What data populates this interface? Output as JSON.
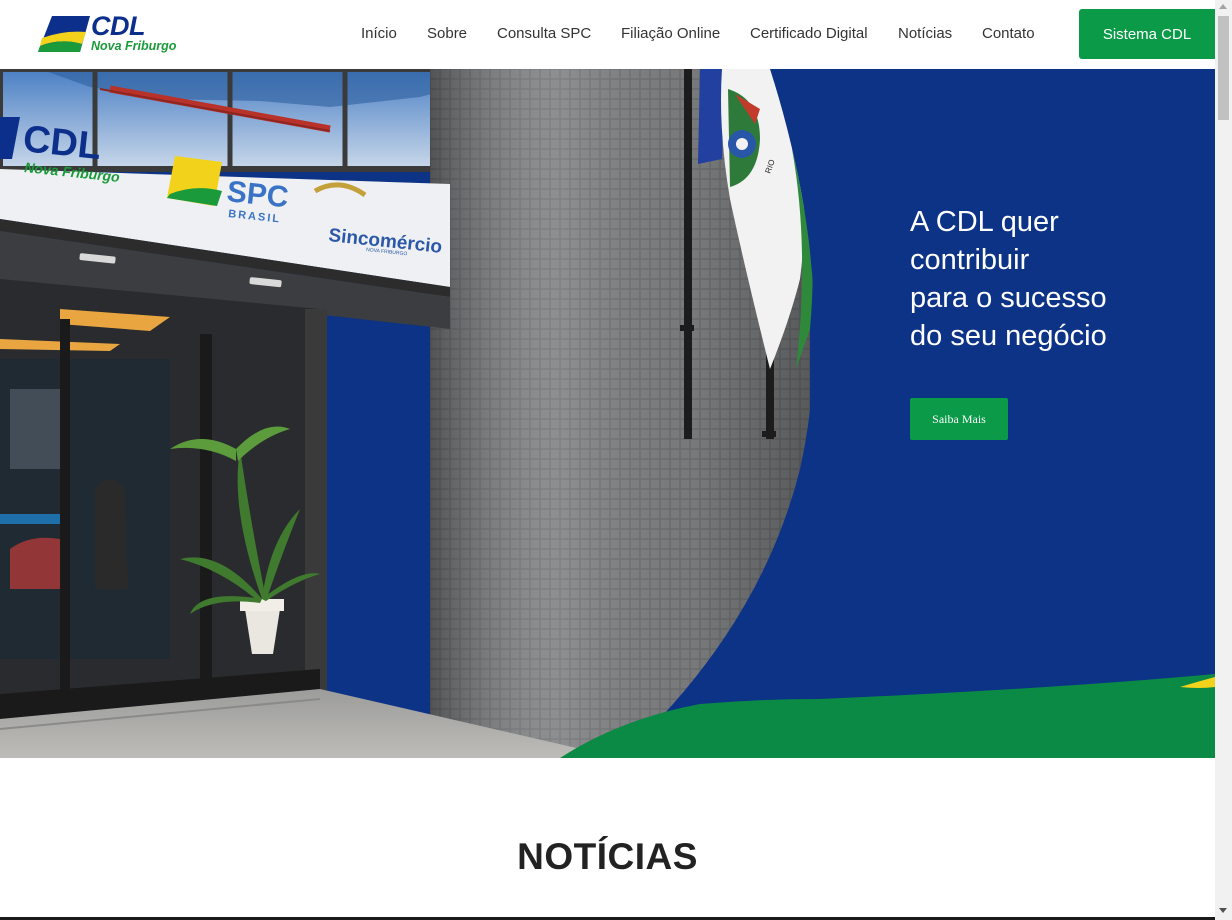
{
  "header": {
    "logo": {
      "name": "CDL",
      "subtitle": "Nova Friburgo",
      "icon": "cdl-logo-icon"
    },
    "nav": [
      {
        "label": "Início"
      },
      {
        "label": "Sobre"
      },
      {
        "label": "Consulta SPC"
      },
      {
        "label": "Filiação Online"
      },
      {
        "label": "Certificado Digital"
      },
      {
        "label": "Notícias"
      },
      {
        "label": "Contato"
      }
    ],
    "cta_label": "Sistema CDL"
  },
  "hero": {
    "headline": [
      "A CDL quer",
      "contribuir",
      "para o sucesso",
      "do seu negócio"
    ],
    "button_label": "Saiba Mais",
    "photo_signs": {
      "cdl": "CDL",
      "cdl_sub": "Nova Friburgo",
      "spc": "SPC",
      "spc_sub": "BRASIL",
      "sinc": "Sincomércio",
      "sinc_sub": "NOVA FRIBURGO"
    }
  },
  "section_title": "NOTÍCIAS",
  "colors": {
    "brand_blue": "#0c3386",
    "brand_green": "#0a9a48",
    "accent_yellow": "#f2d21b"
  }
}
